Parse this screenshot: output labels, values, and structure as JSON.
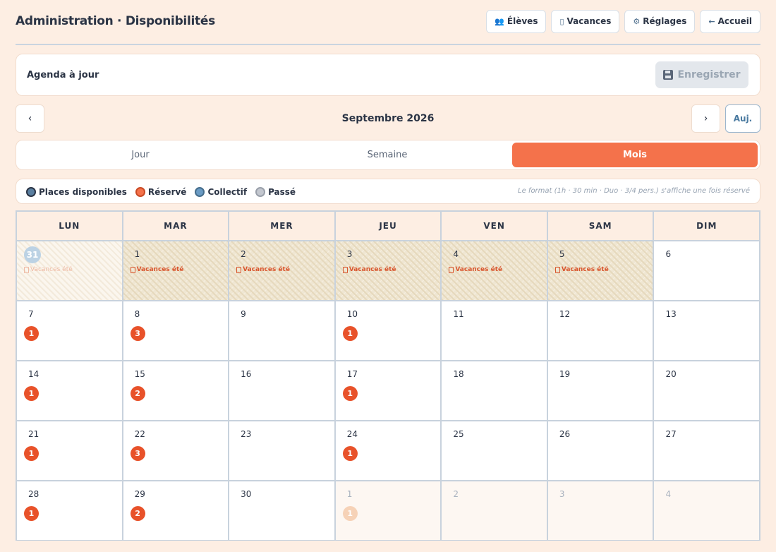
{
  "header": {
    "title": "Administration · Disponibilités",
    "nav": [
      {
        "icon": "👥",
        "label": "Élèves",
        "name": "students"
      },
      {
        "icon": "▯",
        "label": "Vacances",
        "name": "holidays"
      },
      {
        "icon": "⚙",
        "label": "Réglages",
        "name": "settings"
      },
      {
        "icon": "←",
        "label": "Accueil",
        "name": "home"
      }
    ]
  },
  "status": {
    "text": "Agenda à jour",
    "save_label": "Enregistrer"
  },
  "month_nav": {
    "prev": "‹",
    "next": "›",
    "label": "Septembre 2026",
    "today": "Auj."
  },
  "views": {
    "day": "Jour",
    "week": "Semaine",
    "month": "Mois",
    "active": "month"
  },
  "legend": {
    "items": [
      {
        "key": "avail",
        "label": "Places disponibles"
      },
      {
        "key": "res",
        "label": "Réservé"
      },
      {
        "key": "coll",
        "label": "Collectif"
      },
      {
        "key": "past",
        "label": "Passé"
      }
    ],
    "note": "Le format (1h · 30 min · Duo · 3/4 pers.) s'affiche une fois réservé"
  },
  "calendar": {
    "weekdays": [
      "LUN",
      "MAR",
      "MER",
      "JEU",
      "VEN",
      "SAM",
      "DIM"
    ],
    "weeks": [
      [
        {
          "day": "31",
          "state": "today-outside",
          "vacation": "Vacances été",
          "vac_faded": true
        },
        {
          "day": "1",
          "state": "vacation",
          "vacation": "Vacances été"
        },
        {
          "day": "2",
          "state": "vacation",
          "vacation": "Vacances été"
        },
        {
          "day": "3",
          "state": "vacation",
          "vacation": "Vacances été"
        },
        {
          "day": "4",
          "state": "vacation",
          "vacation": "Vacances été"
        },
        {
          "day": "5",
          "state": "vacation",
          "vacation": "Vacances été"
        },
        {
          "day": "6",
          "state": "normal"
        }
      ],
      [
        {
          "day": "7",
          "state": "normal",
          "badge": "1"
        },
        {
          "day": "8",
          "state": "normal",
          "badge": "3"
        },
        {
          "day": "9",
          "state": "normal"
        },
        {
          "day": "10",
          "state": "normal",
          "badge": "1"
        },
        {
          "day": "11",
          "state": "normal"
        },
        {
          "day": "12",
          "state": "normal"
        },
        {
          "day": "13",
          "state": "normal"
        }
      ],
      [
        {
          "day": "14",
          "state": "normal",
          "badge": "1"
        },
        {
          "day": "15",
          "state": "normal",
          "badge": "2"
        },
        {
          "day": "16",
          "state": "normal"
        },
        {
          "day": "17",
          "state": "normal",
          "badge": "1"
        },
        {
          "day": "18",
          "state": "normal"
        },
        {
          "day": "19",
          "state": "normal"
        },
        {
          "day": "20",
          "state": "normal"
        }
      ],
      [
        {
          "day": "21",
          "state": "normal",
          "badge": "1"
        },
        {
          "day": "22",
          "state": "normal",
          "badge": "3"
        },
        {
          "day": "23",
          "state": "normal"
        },
        {
          "day": "24",
          "state": "normal",
          "badge": "1"
        },
        {
          "day": "25",
          "state": "normal"
        },
        {
          "day": "26",
          "state": "normal"
        },
        {
          "day": "27",
          "state": "normal"
        }
      ],
      [
        {
          "day": "28",
          "state": "normal",
          "badge": "1"
        },
        {
          "day": "29",
          "state": "normal",
          "badge": "2"
        },
        {
          "day": "30",
          "state": "normal"
        },
        {
          "day": "1",
          "state": "outside",
          "badge": "1",
          "badge_faded": true
        },
        {
          "day": "2",
          "state": "outside"
        },
        {
          "day": "3",
          "state": "outside"
        },
        {
          "day": "4",
          "state": "outside"
        }
      ]
    ]
  }
}
